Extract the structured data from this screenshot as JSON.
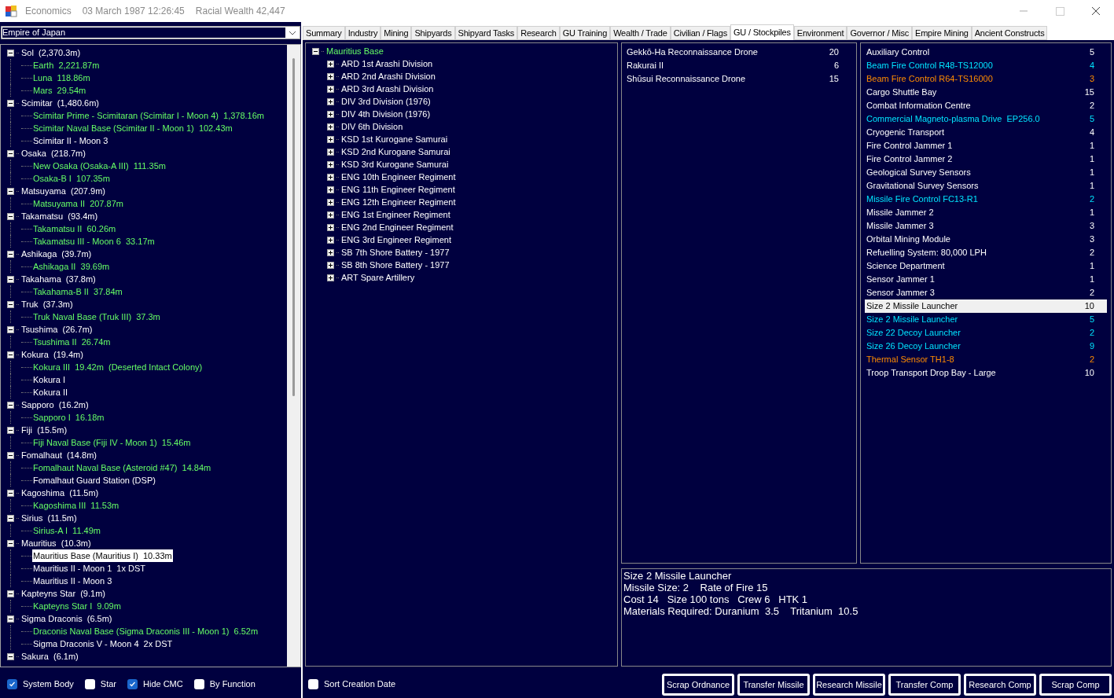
{
  "window": {
    "title": "Economics",
    "date": "03 March 1987 12:26:45",
    "wealth": "Racial Wealth 42,447"
  },
  "empire_select": {
    "value": "Empire of Japan"
  },
  "systems_tree": [
    {
      "label": "Sol  (2,370.3m)",
      "expanded": true,
      "children": [
        {
          "label": "Earth  2,221.87m",
          "color": "#66ff66",
          "selected": false
        },
        {
          "label": "Luna  118.86m",
          "color": "#66ff66",
          "selected": false
        },
        {
          "label": "Mars  29.54m",
          "color": "#66ff66",
          "selected": false
        }
      ]
    },
    {
      "label": "Scimitar  (1,480.6m)",
      "expanded": true,
      "children": [
        {
          "label": "Scimitar Prime - Scimitaran (Scimitar I - Moon 4)  1,378.16m",
          "color": "#66ff66",
          "selected": false
        },
        {
          "label": "Scimitar Naval Base (Scimitar II - Moon 1)  102.43m",
          "color": "#66ff66",
          "selected": false
        },
        {
          "label": "Scimitar II - Moon 3",
          "color": "#ffffff",
          "selected": false
        }
      ]
    },
    {
      "label": "Osaka  (218.7m)",
      "expanded": true,
      "children": [
        {
          "label": "New Osaka (Osaka-A III)  111.35m",
          "color": "#66ff66",
          "selected": false
        },
        {
          "label": "Osaka-B I  107.35m",
          "color": "#66ff66",
          "selected": false
        }
      ]
    },
    {
      "label": "Matsuyama  (207.9m)",
      "expanded": true,
      "children": [
        {
          "label": "Matsuyama II  207.87m",
          "color": "#66ff66",
          "selected": false
        }
      ]
    },
    {
      "label": "Takamatsu  (93.4m)",
      "expanded": true,
      "children": [
        {
          "label": "Takamatsu II  60.26m",
          "color": "#66ff66",
          "selected": false
        },
        {
          "label": "Takamatsu III - Moon 6  33.17m",
          "color": "#66ff66",
          "selected": false
        }
      ]
    },
    {
      "label": "Ashikaga  (39.7m)",
      "expanded": true,
      "children": [
        {
          "label": "Ashikaga II  39.69m",
          "color": "#66ff66",
          "selected": false
        }
      ]
    },
    {
      "label": "Takahama  (37.8m)",
      "expanded": true,
      "children": [
        {
          "label": "Takahama-B II  37.84m",
          "color": "#66ff66",
          "selected": false
        }
      ]
    },
    {
      "label": "Truk  (37.3m)",
      "expanded": true,
      "children": [
        {
          "label": "Truk Naval Base (Truk III)  37.3m",
          "color": "#66ff66",
          "selected": false
        }
      ]
    },
    {
      "label": "Tsushima  (26.7m)",
      "expanded": true,
      "children": [
        {
          "label": "Tsushima II  26.74m",
          "color": "#66ff66",
          "selected": false
        }
      ]
    },
    {
      "label": "Kokura  (19.4m)",
      "expanded": true,
      "children": [
        {
          "label": "Kokura III  19.42m  (Deserted Intact Colony)",
          "color": "#66ff66",
          "selected": false
        },
        {
          "label": "Kokura I",
          "color": "#ffffff",
          "selected": false
        },
        {
          "label": "Kokura II",
          "color": "#ffffff",
          "selected": false
        }
      ]
    },
    {
      "label": "Sapporo  (16.2m)",
      "expanded": true,
      "children": [
        {
          "label": "Sapporo I  16.18m",
          "color": "#66ff66",
          "selected": false
        }
      ]
    },
    {
      "label": "Fiji  (15.5m)",
      "expanded": true,
      "children": [
        {
          "label": "Fiji Naval Base (Fiji IV - Moon 1)  15.46m",
          "color": "#66ff66",
          "selected": false
        }
      ]
    },
    {
      "label": "Fomalhaut  (14.8m)",
      "expanded": true,
      "children": [
        {
          "label": "Fomalhaut Naval Base (Asteroid #47)  14.84m",
          "color": "#66ff66",
          "selected": false
        },
        {
          "label": "Fomalhaut Guard Station (DSP)",
          "color": "#ffffff",
          "selected": false
        }
      ]
    },
    {
      "label": "Kagoshima  (11.5m)",
      "expanded": true,
      "children": [
        {
          "label": "Kagoshima III  11.53m",
          "color": "#66ff66",
          "selected": false
        }
      ]
    },
    {
      "label": "Sirius  (11.5m)",
      "expanded": true,
      "children": [
        {
          "label": "Sirius-A I  11.49m",
          "color": "#66ff66",
          "selected": false
        }
      ]
    },
    {
      "label": "Mauritius  (10.3m)",
      "expanded": true,
      "children": [
        {
          "label": "Mauritius Base (Mauritius I)  10.33m",
          "color": "#000000",
          "selected": true
        },
        {
          "label": "Mauritius II - Moon 1  1x DST",
          "color": "#ffffff",
          "selected": false
        },
        {
          "label": "Mauritius II - Moon 3",
          "color": "#ffffff",
          "selected": false
        }
      ]
    },
    {
      "label": "Kapteyns Star  (9.1m)",
      "expanded": true,
      "children": [
        {
          "label": "Kapteyns Star I  9.09m",
          "color": "#66ff66",
          "selected": false
        }
      ]
    },
    {
      "label": "Sigma Draconis  (6.5m)",
      "expanded": true,
      "children": [
        {
          "label": "Draconis Naval Base (Sigma Draconis III - Moon 1)  6.52m",
          "color": "#66ff66",
          "selected": false
        },
        {
          "label": "Sigma Draconis V - Moon 4  2x DST",
          "color": "#ffffff",
          "selected": false
        }
      ]
    },
    {
      "label": "Sakura  (6.1m)",
      "expanded": true
    }
  ],
  "filters": [
    {
      "label": "System Body",
      "checked": true
    },
    {
      "label": "Star",
      "checked": false
    },
    {
      "label": "Hide CMC",
      "checked": true
    },
    {
      "label": "By Function",
      "checked": false
    }
  ],
  "tabs": [
    {
      "label": "Summary",
      "selected": false
    },
    {
      "label": "Industry",
      "selected": false
    },
    {
      "label": "Mining",
      "selected": false
    },
    {
      "label": "Shipyards",
      "selected": false
    },
    {
      "label": "Shipyard Tasks",
      "selected": false
    },
    {
      "label": "Research",
      "selected": false
    },
    {
      "label": "GU Training",
      "selected": false
    },
    {
      "label": "Wealth / Trade",
      "selected": false
    },
    {
      "label": "Civilian / Flags",
      "selected": false
    },
    {
      "label": "GU / Stockpiles",
      "selected": true
    },
    {
      "label": "Environment",
      "selected": false
    },
    {
      "label": "Governor / Misc",
      "selected": false
    },
    {
      "label": "Empire Mining",
      "selected": false
    },
    {
      "label": "Ancient Constructs",
      "selected": false
    }
  ],
  "ground_units_tree": {
    "label": "Mauritius Base",
    "expanded": true,
    "children": [
      {
        "label": "ARD 1st Arashi Division",
        "expanded": false
      },
      {
        "label": "ARD 2nd Arashi Division",
        "expanded": false
      },
      {
        "label": "ARD 3rd Arashi Division",
        "expanded": false
      },
      {
        "label": "DIV 3rd Division (1976)",
        "expanded": false
      },
      {
        "label": "DIV 4th Division (1976)",
        "expanded": false
      },
      {
        "label": "DIV 6th Division",
        "expanded": false
      },
      {
        "label": "KSD 1st Kurogane Samurai",
        "expanded": false
      },
      {
        "label": "KSD 2nd Kurogane Samurai",
        "expanded": false
      },
      {
        "label": "KSD 3rd Kurogane Samurai",
        "expanded": false
      },
      {
        "label": "ENG 10th Engineer Regiment",
        "expanded": false
      },
      {
        "label": "ENG 11th Engineer Regiment",
        "expanded": false
      },
      {
        "label": "ENG 12th Engineer Regiment",
        "expanded": false
      },
      {
        "label": "ENG 1st Engineer Regiment",
        "expanded": false
      },
      {
        "label": "ENG 2nd Engineer Regiment",
        "expanded": false
      },
      {
        "label": "ENG 3rd Engineer Regiment",
        "expanded": false
      },
      {
        "label": "SB 7th Shore Battery - 1977",
        "expanded": false
      },
      {
        "label": "SB 8th Shore Battery - 1977",
        "expanded": false
      },
      {
        "label": "ART Spare Artillery",
        "expanded": false
      }
    ]
  },
  "sort_creation_date": {
    "label": "Sort Creation Date",
    "checked": false
  },
  "missile_stockpile": [
    {
      "name": "Gekkō-Ha Reconnaissance Drone",
      "count": "20"
    },
    {
      "name": "Rakurai II",
      "count": "6"
    },
    {
      "name": "Shūsui Reconnaissance Drone",
      "count": "15"
    }
  ],
  "component_stockpile": [
    {
      "name": "Auxiliary Control",
      "count": "5",
      "color": "#ffffff",
      "selected": false
    },
    {
      "name": "Beam Fire Control R48-TS12000",
      "count": "4",
      "color": "#00e5ff",
      "selected": false
    },
    {
      "name": "Beam Fire Control R64-TS16000",
      "count": "3",
      "color": "#ff8c00",
      "selected": false
    },
    {
      "name": "Cargo Shuttle Bay",
      "count": "15",
      "color": "#ffffff",
      "selected": false
    },
    {
      "name": "Combat Information Centre",
      "count": "2",
      "color": "#ffffff",
      "selected": false
    },
    {
      "name": "Commercial Magneto-plasma Drive  EP256.0",
      "count": "5",
      "color": "#00e5ff",
      "selected": false
    },
    {
      "name": "Cryogenic Transport",
      "count": "4",
      "color": "#ffffff",
      "selected": false
    },
    {
      "name": "Fire Control Jammer 1",
      "count": "1",
      "color": "#ffffff",
      "selected": false
    },
    {
      "name": "Fire Control Jammer 2",
      "count": "1",
      "color": "#ffffff",
      "selected": false
    },
    {
      "name": "Geological Survey Sensors",
      "count": "1",
      "color": "#ffffff",
      "selected": false
    },
    {
      "name": "Gravitational Survey Sensors",
      "count": "1",
      "color": "#ffffff",
      "selected": false
    },
    {
      "name": "Missile Fire Control FC13-R1",
      "count": "2",
      "color": "#00e5ff",
      "selected": false
    },
    {
      "name": "Missile Jammer 2",
      "count": "1",
      "color": "#ffffff",
      "selected": false
    },
    {
      "name": "Missile Jammer 3",
      "count": "3",
      "color": "#ffffff",
      "selected": false
    },
    {
      "name": "Orbital Mining Module",
      "count": "3",
      "color": "#ffffff",
      "selected": false
    },
    {
      "name": "Refuelling System: 80,000 LPH",
      "count": "2",
      "color": "#ffffff",
      "selected": false
    },
    {
      "name": "Science Department",
      "count": "1",
      "color": "#ffffff",
      "selected": false
    },
    {
      "name": "Sensor Jammer 1",
      "count": "1",
      "color": "#ffffff",
      "selected": false
    },
    {
      "name": "Sensor Jammer 3",
      "count": "2",
      "color": "#ffffff",
      "selected": false
    },
    {
      "name": "Size 2 Missile Launcher",
      "count": "10",
      "color": "#000000",
      "selected": true
    },
    {
      "name": "Size 2 Missile Launcher",
      "count": "5",
      "color": "#00e5ff",
      "selected": false
    },
    {
      "name": "Size 22 Decoy Launcher",
      "count": "2",
      "color": "#00e5ff",
      "selected": false
    },
    {
      "name": "Size 26 Decoy Launcher",
      "count": "9",
      "color": "#00e5ff",
      "selected": false
    },
    {
      "name": "Thermal Sensor TH1-8",
      "count": "2",
      "color": "#ff8c00",
      "selected": false
    },
    {
      "name": "Troop Transport Drop Bay - Large",
      "count": "10",
      "color": "#ffffff",
      "selected": false
    }
  ],
  "details": [
    "Size 2 Missile Launcher",
    "Missile Size: 2    Rate of Fire 15",
    "Cost 14   Size 100 tons   Crew 6   HTK 1",
    "Materials Required: Duranium  3.5    Tritanium  10.5"
  ],
  "buttons": [
    "Scrap Ordnance",
    "Transfer Missile",
    "Research Missile",
    "Transfer Comp",
    "Research Comp",
    "Scrap Comp"
  ]
}
